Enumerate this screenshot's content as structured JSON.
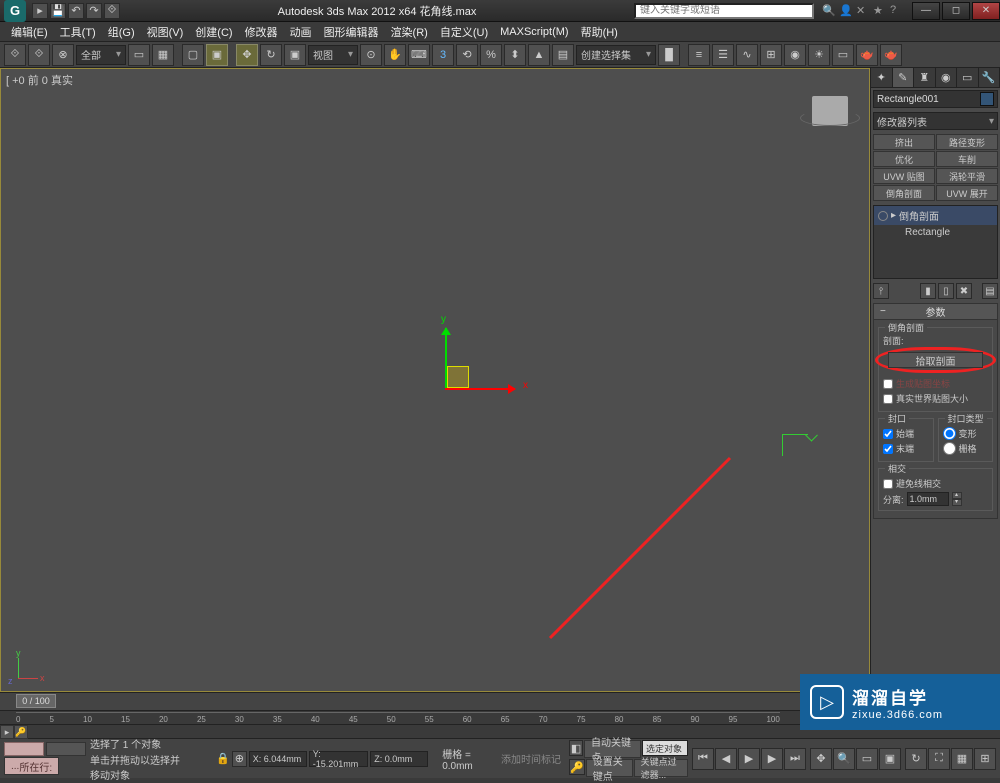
{
  "title": "Autodesk 3ds Max  2012 x64     花角线.max",
  "search_placeholder": "键入关键字或短语",
  "menu": [
    "编辑(E)",
    "工具(T)",
    "组(G)",
    "视图(V)",
    "创建(C)",
    "修改器",
    "动画",
    "图形编辑器",
    "渲染(R)",
    "自定义(U)",
    "MAXScript(M)",
    "帮助(H)"
  ],
  "toolbar_all": "全部",
  "toolbar_view": "视图",
  "toolbar_selset": "创建选择集",
  "viewport_label": "[ +0 前 0 真实",
  "axis": {
    "x": "x",
    "y": "y",
    "z": "z"
  },
  "time_slider": "0 / 100",
  "ticks": [
    "0",
    "5",
    "10",
    "15",
    "20",
    "25",
    "30",
    "35",
    "40",
    "45",
    "50",
    "55",
    "60",
    "65",
    "70",
    "75",
    "80",
    "85",
    "90",
    "95",
    "100"
  ],
  "right": {
    "obj_name": "Rectangle001",
    "mod_list": "修改器列表",
    "btns": [
      "挤出",
      "路径变形",
      "优化",
      "车削",
      "UVW 贴图",
      "涡轮平滑",
      "倒角剖面",
      "UVW 展开"
    ],
    "stack": [
      {
        "name": "倒角剖面",
        "sel": true
      },
      {
        "name": "Rectangle",
        "sel": false
      }
    ],
    "rollout_title": "参数",
    "group1_title": "倒角剖面",
    "profile_label": "剖面:",
    "pick_btn": "拾取剖面",
    "gen_mat": "生成贴图坐标",
    "real_world": "真实世界贴图大小",
    "cap_group": "封口",
    "cap_start": "始端",
    "cap_end": "末端",
    "cap_type_group": "封口类型",
    "cap_morph": "变形",
    "cap_grid": "栅格",
    "intersect_group": "相交",
    "avoid_intersect": "避免线相交",
    "separation_label": "分离:",
    "separation_value": "1.0mm"
  },
  "status": {
    "now_label": "所在行:",
    "selected": "选择了 1 个对象",
    "hint": "单击并拖动以选择并移动对象",
    "x": "X: 6.044mm",
    "y": "Y: -15.201mm",
    "z": "Z: 0.0mm",
    "grid": "栅格 = 0.0mm",
    "autokey": "自动关键点",
    "selkey": "选定对象",
    "setkey": "设置关键点",
    "keyfilter": "关键点过滤器...",
    "addtime": "添加时间标记"
  },
  "watermark": {
    "title": "溜溜自学",
    "url": "zixue.3d66.com"
  }
}
